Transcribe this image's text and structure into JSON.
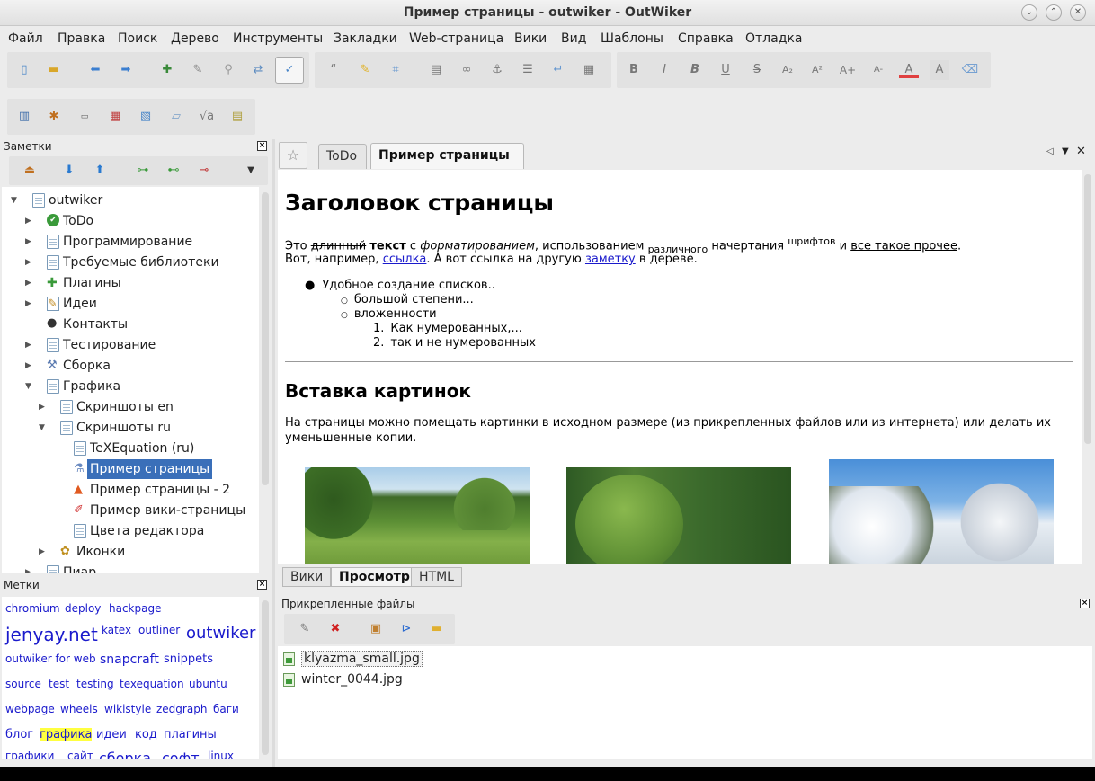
{
  "window": {
    "title": "Пример страницы - outwiker - OutWiker"
  },
  "menu": [
    "Файл",
    "Правка",
    "Поиск",
    "Дерево",
    "Инструменты",
    "Закладки",
    "Web-страница",
    "Вики",
    "Вид",
    "Шаблоны",
    "Справка",
    "Отладка"
  ],
  "toolbar": {
    "format_icons": [
      "bold-icon",
      "italic-icon",
      "bold-italic-icon",
      "underline-icon",
      "strike-icon",
      "subscript-icon",
      "superscript-icon",
      "font-bigger-icon",
      "font-smaller-icon",
      "text-color-icon",
      "background-color-icon",
      "clear-format-icon"
    ],
    "letters": {
      "bold": "B",
      "italic": "I",
      "bold_italic": "B",
      "underline": "U",
      "strike": "S",
      "subscript": "A₂",
      "superscript": "A²",
      "bigger": "A+",
      "smaller": "A-",
      "color": "A",
      "bg": "A"
    }
  },
  "notes_panel": {
    "title": "Заметки",
    "tree": [
      {
        "label": "outwiker",
        "level": 0,
        "expanded": true,
        "icon": "page-icon"
      },
      {
        "label": "ToDo",
        "level": 1,
        "expanded": false,
        "icon": "check-icon"
      },
      {
        "label": "Программирование",
        "level": 1,
        "expanded": false,
        "icon": "page-icon"
      },
      {
        "label": "Требуемые библиотеки",
        "level": 1,
        "expanded": false,
        "icon": "page-icon"
      },
      {
        "label": "Плагины",
        "level": 1,
        "expanded": false,
        "icon": "puzzle-icon"
      },
      {
        "label": "Идеи",
        "level": 1,
        "expanded": false,
        "icon": "notepad-icon"
      },
      {
        "label": "Контакты",
        "level": 1,
        "expanded": null,
        "icon": "person-icon"
      },
      {
        "label": "Тестирование",
        "level": 1,
        "expanded": false,
        "icon": "page-icon"
      },
      {
        "label": "Сборка",
        "level": 1,
        "expanded": false,
        "icon": "wrench-icon"
      },
      {
        "label": "Графика",
        "level": 1,
        "expanded": true,
        "icon": "page-icon"
      },
      {
        "label": "Скриншоты en",
        "level": 2,
        "expanded": false,
        "icon": "page-icon"
      },
      {
        "label": "Скриншоты ru",
        "level": 2,
        "expanded": true,
        "icon": "page-icon"
      },
      {
        "label": "TeXEquation (ru)",
        "level": 3,
        "expanded": null,
        "icon": "page-icon"
      },
      {
        "label": "Пример страницы",
        "level": 3,
        "expanded": null,
        "icon": "bottle-icon",
        "selected": true
      },
      {
        "label": "Пример страницы - 2",
        "level": 3,
        "expanded": null,
        "icon": "cone-icon"
      },
      {
        "label": "Пример вики-страницы",
        "level": 3,
        "expanded": null,
        "icon": "brush-icon"
      },
      {
        "label": "Цвета редактора",
        "level": 3,
        "expanded": null,
        "icon": "page-icon"
      },
      {
        "label": "Иконки",
        "level": 2,
        "expanded": false,
        "icon": "palette-icon"
      },
      {
        "label": "Пиар",
        "level": 1,
        "expanded": false,
        "icon": "page-icon"
      }
    ]
  },
  "tags_panel": {
    "title": "Метки",
    "tags": [
      {
        "label": "chromium",
        "size": 12
      },
      {
        "label": "deploy",
        "size": 12
      },
      {
        "label": "hackpage",
        "size": 12
      },
      {
        "label": "jenyay.net",
        "size": 20
      },
      {
        "label": "katex",
        "size": 12
      },
      {
        "label": "outliner",
        "size": 12
      },
      {
        "label": "outwiker",
        "size": 18
      },
      {
        "label": "outwiker for web",
        "size": 12
      },
      {
        "label": "snapcraft",
        "size": 14
      },
      {
        "label": "snippets",
        "size": 13
      },
      {
        "label": "source",
        "size": 12
      },
      {
        "label": "test",
        "size": 12
      },
      {
        "label": "testing",
        "size": 12
      },
      {
        "label": "texequation",
        "size": 12
      },
      {
        "label": "ubuntu",
        "size": 12
      },
      {
        "label": "webpage",
        "size": 12
      },
      {
        "label": "wheels",
        "size": 12
      },
      {
        "label": "wikistyle",
        "size": 12
      },
      {
        "label": "zedgraph",
        "size": 12
      },
      {
        "label": "баги",
        "size": 12
      },
      {
        "label": "блог",
        "size": 13
      },
      {
        "label": "графика",
        "size": 13,
        "highlight": true
      },
      {
        "label": "идеи",
        "size": 13
      },
      {
        "label": "код",
        "size": 13
      },
      {
        "label": "плагины",
        "size": 13
      },
      {
        "label": "графики",
        "size": 12
      },
      {
        "label": "сайт",
        "size": 12
      },
      {
        "label": "сборка",
        "size": 16
      },
      {
        "label": "софт",
        "size": 16
      },
      {
        "label": "linux",
        "size": 12
      }
    ]
  },
  "tabs": [
    {
      "label": "ToDo",
      "active": false
    },
    {
      "label": "Пример страницы",
      "active": true,
      "close": "×"
    }
  ],
  "page": {
    "h1": "Заголовок страницы",
    "p1": {
      "t1": "Это ",
      "strike": "длинный",
      "t2": " ",
      "bold": "текст",
      "t3": " с ",
      "italic": "форматированием",
      "t4": ", использованием ",
      "sub": "различного",
      "t5": " начертания ",
      "sup": "шрифтов",
      "t6": " и ",
      "underline": "все такое прочее",
      "t7": "."
    },
    "p2": {
      "t1": "Вот, например, ",
      "link1": "ссылка",
      "t2": ". А вот ссылка на другую ",
      "link2": "заметку",
      "t3": " в дереве."
    },
    "list": {
      "l1": "Удобное создание списков..",
      "l2": "большой степени...",
      "l3": "вложенности",
      "n1": "Как нумерованных,...",
      "n2": "так и не нумерованных",
      "num1": "1.",
      "num2": "2."
    },
    "h2": "Вставка картинок",
    "p3a": "На страницы можно помещать картинки в исходном размере (из прикрепленных файлов или из интернета) или делать их",
    "p3b": "уменьшенные копии."
  },
  "view_tabs": [
    {
      "label": "Вики",
      "active": false
    },
    {
      "label": "Просмотр",
      "active": true
    },
    {
      "label": "HTML",
      "active": false
    }
  ],
  "attachments": {
    "title": "Прикрепленные файлы",
    "files": [
      "klyazma_small.jpg",
      "winter_0044.jpg"
    ]
  }
}
